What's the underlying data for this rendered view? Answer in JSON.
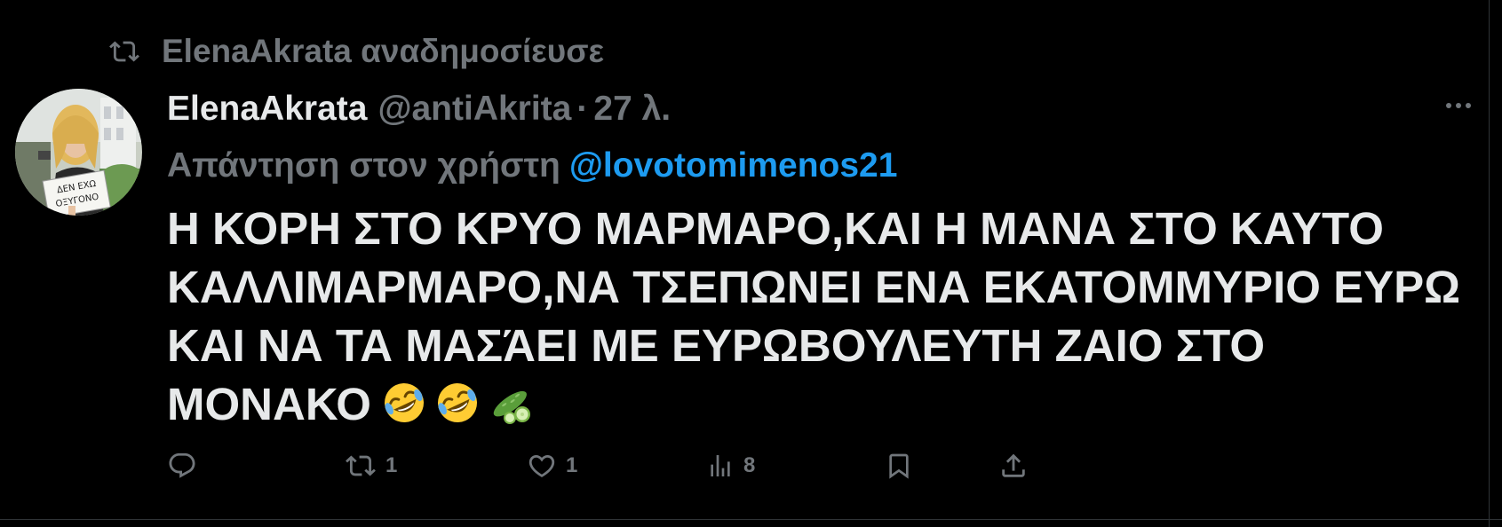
{
  "repost": {
    "icon": "repost-icon",
    "text": "ElenaAkrata αναδημοσίευσε"
  },
  "author": {
    "display_name": "ElenaAkrata",
    "handle": "@antiAkrita",
    "separator": "·",
    "time": "27 λ."
  },
  "reply": {
    "label": "Απάντηση στον χρήστη",
    "mention": "@lovotomimenos21"
  },
  "tweet": {
    "text": "Η ΚΟΡΗ ΣΤΟ ΚΡΥΟ ΜΑΡΜΑΡΟ,ΚΑΙ Η ΜΑΝΑ ΣΤΟ ΚΑΥΤΟ ΚΑΛΛΙΜΑΡΜΑΡΟ,ΝΑ ΤΣΕΠΩΝΕΙ ΕΝΑ ΕΚΑΤΟΜΜΥΡΙΟ ΕΥΡΩ ΚΑΙ ΝΑ ΤΑ ΜΑΣΆΕΙ ΜΕ ΕΥΡΩΒΟΥΛΕΥΤΗ ΖΑΙΟ ΣΤΟ ΜΟΝΑΚΟ",
    "emojis": [
      "rolling-on-floor-laughing-emoji",
      "rolling-on-floor-laughing-emoji",
      "cucumber-emoji"
    ]
  },
  "actions": {
    "reply_count": "",
    "repost_count": "1",
    "like_count": "1",
    "views_count": "8"
  },
  "avatar": {
    "sign_text": "ΔΕΝ ΕΧΩ ΟΞΥΓΟΝΟ"
  },
  "colors": {
    "background": "#000000",
    "text_primary": "#e7e9ea",
    "text_secondary": "#71767b",
    "accent": "#1d9bf0",
    "divider": "#2f3336"
  }
}
